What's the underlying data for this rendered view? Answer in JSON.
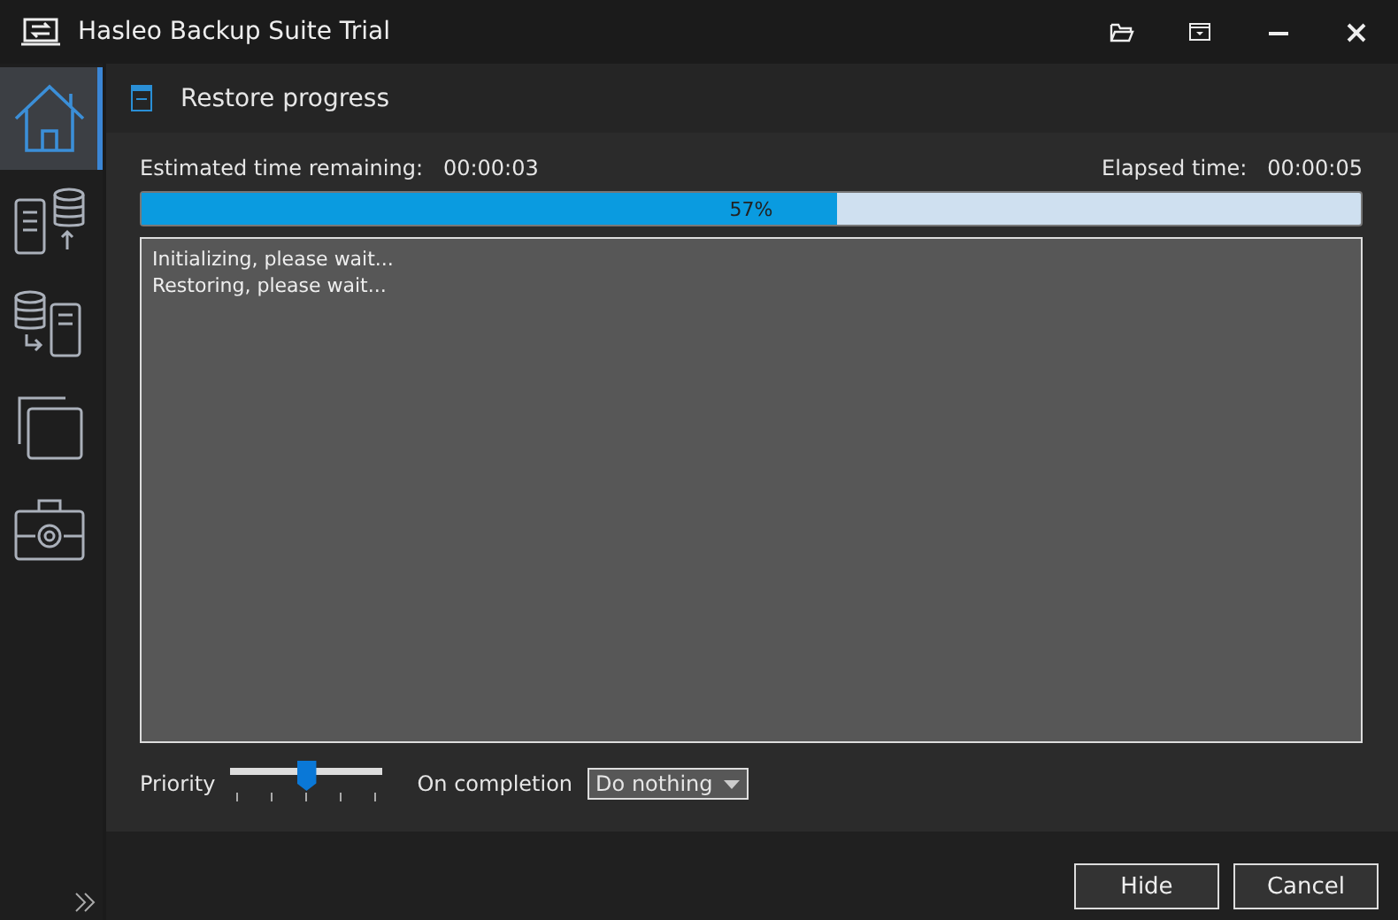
{
  "window": {
    "title": "Hasleo Backup Suite Trial"
  },
  "sidebar": {
    "items": [
      {
        "kind": "home",
        "selected": true
      },
      {
        "kind": "backup",
        "selected": false
      },
      {
        "kind": "restore",
        "selected": false
      },
      {
        "kind": "clone",
        "selected": false
      },
      {
        "kind": "tools",
        "selected": false
      }
    ]
  },
  "header": {
    "title": "Restore progress"
  },
  "progress": {
    "remaining_label": "Estimated time remaining:",
    "remaining": "00:00:03",
    "elapsed_label": "Elapsed time:",
    "elapsed": "00:00:05",
    "level": 0.57,
    "percent": "57%"
  },
  "log": [
    "Initializing, please wait...",
    "Restoring, please wait..."
  ],
  "priority": {
    "label": "Priority",
    "level": 0.5
  },
  "completion": {
    "label": "On completion",
    "value": "Do nothing"
  },
  "buttons": [
    "Hide",
    "Cancel"
  ]
}
